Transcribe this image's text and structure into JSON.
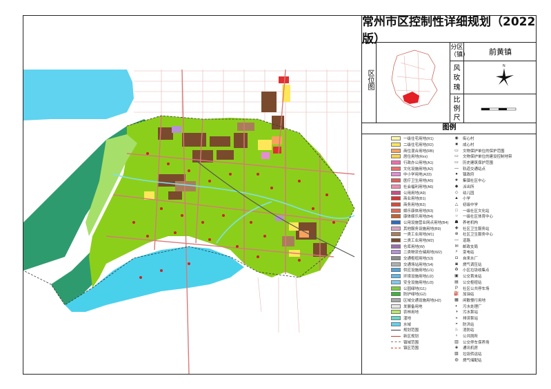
{
  "title": "常州市区控制性详细规划（2022版）",
  "locator": {
    "label": "区位图",
    "district_label": "分区（镇）",
    "district_value": "前黄镇",
    "rose_label": "风玫瑰",
    "scale_label": "比例尺"
  },
  "legend": {
    "title": "图例",
    "landuse": [
      {
        "label": "一级住宅用地(R1)",
        "color": "#fff9a6"
      },
      {
        "label": "二级住宅用地(R2)",
        "color": "#ffe75a"
      },
      {
        "label": "商住混合用地(RB)",
        "color": "#f7a35c"
      },
      {
        "label": "居住用地(Rxx)",
        "color": "#ffd34d"
      },
      {
        "label": "行政办公用地(A1)",
        "color": "#ef6bb0"
      },
      {
        "label": "文化设施用地(A2)",
        "color": "#f06c6c"
      },
      {
        "label": "中小学用地(A33)",
        "color": "#e68cd6"
      },
      {
        "label": "医疗卫生用地(A5)",
        "color": "#e25b5b"
      },
      {
        "label": "社会福利用地(A6)",
        "color": "#f28cb0"
      },
      {
        "label": "公用用地(A9)",
        "color": "#c74f86"
      },
      {
        "label": "商业用地(B1)",
        "color": "#e03030"
      },
      {
        "label": "商务用地(B2)",
        "color": "#d94a3a"
      },
      {
        "label": "娱乐康体用地(B3)",
        "color": "#e06a5a"
      },
      {
        "label": "康体娱乐用地(B4)",
        "color": "#c9602b"
      },
      {
        "label": "公用设施营业网点用地(B4)",
        "color": "#2c6bbf"
      },
      {
        "label": "其他服务设施用地(B9)",
        "color": "#d7a3c6"
      },
      {
        "label": "一类工业用地(M1)",
        "color": "#a97d5b"
      },
      {
        "label": "二类工业用地(M2)",
        "color": "#7a4a2d"
      },
      {
        "label": "仓库用地(W)",
        "color": "#9a6fb0"
      },
      {
        "label": "二类物流仓储用地(W2)",
        "color": "#b68fd6"
      },
      {
        "label": "交通枢纽用地(S3)",
        "color": "#8c8c8c"
      },
      {
        "label": "交通场站用地(S4)",
        "color": "#b0b0b0"
      },
      {
        "label": "供应设施用地(U1)",
        "color": "#4fa3d9"
      },
      {
        "label": "环境设施用地(U2)",
        "color": "#5fb7e6"
      },
      {
        "label": "安全设施用地(U3)",
        "color": "#7fcaf0"
      },
      {
        "label": "公园绿地(G1)",
        "color": "#7ccf3c"
      },
      {
        "label": "防护绿地(G2)",
        "color": "#3cb43c"
      },
      {
        "label": "区域交通设施用地(H2)",
        "color": "#a8a8a8"
      },
      {
        "label": "发展备用地",
        "color": "#e8e8e8"
      },
      {
        "label": "农林用地",
        "color": "#b7e86b"
      },
      {
        "label": "湿地",
        "color": "#66d9c9"
      },
      {
        "label": "水域",
        "color": "#5fd3f0"
      }
    ],
    "lines": [
      {
        "label": "规划范围",
        "color": "#333333",
        "style": "solid"
      },
      {
        "label": "新区规划",
        "color": "#c0392b",
        "style": "solid"
      },
      {
        "label": "镇域范围",
        "color": "#777777",
        "style": "dashed"
      },
      {
        "label": "镇区范围",
        "color": "#c0392b",
        "style": "dashed"
      }
    ],
    "facilities": [
      {
        "label": "街心村",
        "glyph": "◉"
      },
      {
        "label": "成心村",
        "glyph": "■"
      },
      {
        "label": "文物保护单位的保护范围",
        "glyph": "▭"
      },
      {
        "label": "文物保护单位的建设控制地带",
        "glyph": "▭"
      },
      {
        "label": "历史建筑保护范围",
        "glyph": "▭"
      },
      {
        "label": "轨道交通站点",
        "glyph": "—"
      },
      {
        "label": "镇政府",
        "glyph": "●"
      },
      {
        "label": "集镇社区中心",
        "glyph": "★"
      },
      {
        "label": "派出所",
        "glyph": "◆"
      },
      {
        "label": "幼儿园",
        "glyph": "◇"
      },
      {
        "label": "小学",
        "glyph": "▲"
      },
      {
        "label": "初级中学",
        "glyph": "△"
      },
      {
        "label": "一级社区文化站",
        "glyph": "□"
      },
      {
        "label": "一级社区体育中心",
        "glyph": "○"
      },
      {
        "label": "养老机构",
        "glyph": "☗"
      },
      {
        "label": "社区卫生服务站",
        "glyph": "✚"
      },
      {
        "label": "社区卫生服务中心",
        "glyph": "⊕"
      },
      {
        "label": "道路",
        "glyph": "—"
      },
      {
        "label": "邮政支局",
        "glyph": "✉"
      },
      {
        "label": "变电站",
        "glyph": "⚡"
      },
      {
        "label": "自来水厂",
        "glyph": "◘"
      },
      {
        "label": "燃气调压站",
        "glyph": "◙"
      },
      {
        "label": "小区垃圾收集点",
        "glyph": "♻"
      },
      {
        "label": "公交首末站",
        "glyph": "▣"
      },
      {
        "label": "公交枢纽站",
        "glyph": "▤"
      },
      {
        "label": "社区公共停车场",
        "glyph": "P"
      },
      {
        "label": "加油站",
        "glyph": "⛽"
      },
      {
        "label": "闲散慢行用地",
        "glyph": "▦"
      },
      {
        "label": "污水处理厂",
        "glyph": "◐"
      },
      {
        "label": "污水泵站",
        "glyph": "◑"
      },
      {
        "label": "排涝泵站",
        "glyph": "◒"
      },
      {
        "label": "防洪站",
        "glyph": "◓"
      },
      {
        "label": "消防站",
        "glyph": "♨"
      },
      {
        "label": "公共厕所",
        "glyph": "♀"
      },
      {
        "label": "公交停车保养场",
        "glyph": "▥"
      },
      {
        "label": "通讯机房",
        "glyph": "◈"
      },
      {
        "label": "垃圾转运站",
        "glyph": "▧"
      },
      {
        "label": "燃气储配站",
        "glyph": "◍"
      }
    ]
  },
  "colors": {
    "water": "#5fd3f0",
    "green_belt": "#2e9b6e",
    "farmland": "#8ccf1a",
    "industrial": "#7a4a2d",
    "road": "#d9797a",
    "frame": "#222222"
  }
}
